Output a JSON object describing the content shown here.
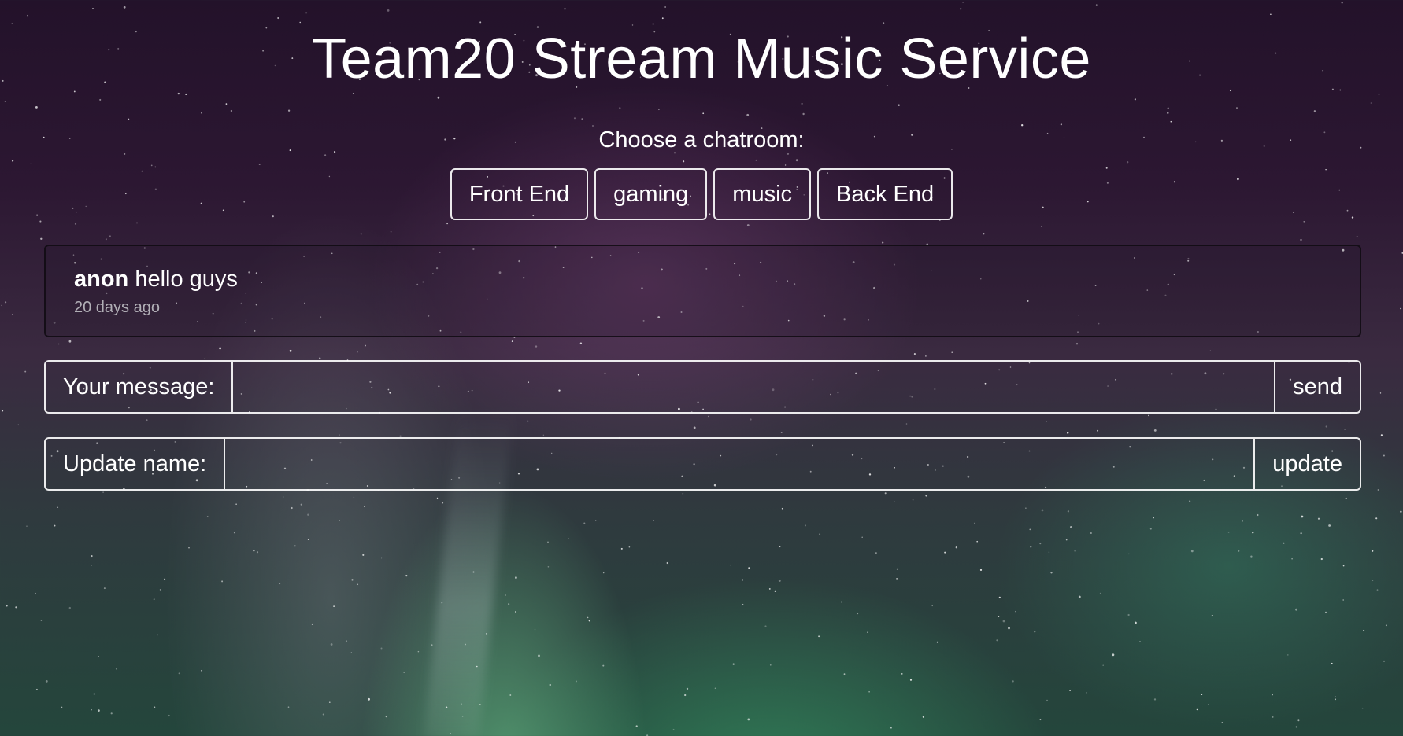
{
  "header": {
    "title": "Team20 Stream Music Service"
  },
  "chatrooms": {
    "prompt": "Choose a chatroom:",
    "rooms": [
      "Front End",
      "gaming",
      "music",
      "Back End"
    ]
  },
  "messages": [
    {
      "author": "anon",
      "text": "hello guys",
      "time": "20 days ago"
    }
  ],
  "message_form": {
    "label": "Your message:",
    "value": "",
    "button": "send"
  },
  "name_form": {
    "label": "Update name:",
    "value": "",
    "button": "update"
  }
}
